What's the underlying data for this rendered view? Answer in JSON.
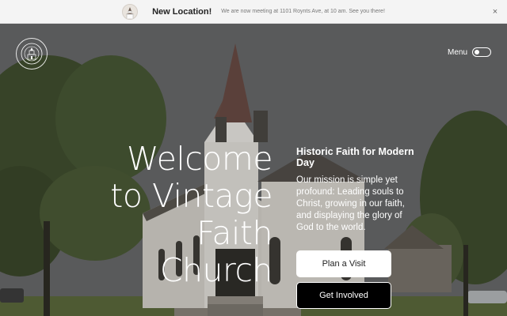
{
  "announcement": {
    "title": "New Location!",
    "text": "We are now meeting at 1101 Roynts Ave, at 10 am. See you there!",
    "close_glyph": "×",
    "thumb_icon": "church-icon"
  },
  "header": {
    "logo_icon": "church-seal-icon",
    "menu_label": "Menu",
    "toggle_icon": "toggle-icon"
  },
  "hero": {
    "heading_lines": [
      "Welcome",
      "to Vintage",
      "Faith",
      "Church"
    ],
    "tagline": "Historic Faith for Modern Day",
    "mission": "Our mission is simple yet profound: Leading souls to Christ, growing in our faith, and displaying the glory of God to the world.",
    "buttons": {
      "visit": "Plan a Visit",
      "involved": "Get Involved"
    }
  },
  "colors": {
    "announce_bg": "#f4f4f4",
    "button_light": "#ffffff",
    "button_dark": "#000000",
    "text_light": "#ffffff"
  }
}
